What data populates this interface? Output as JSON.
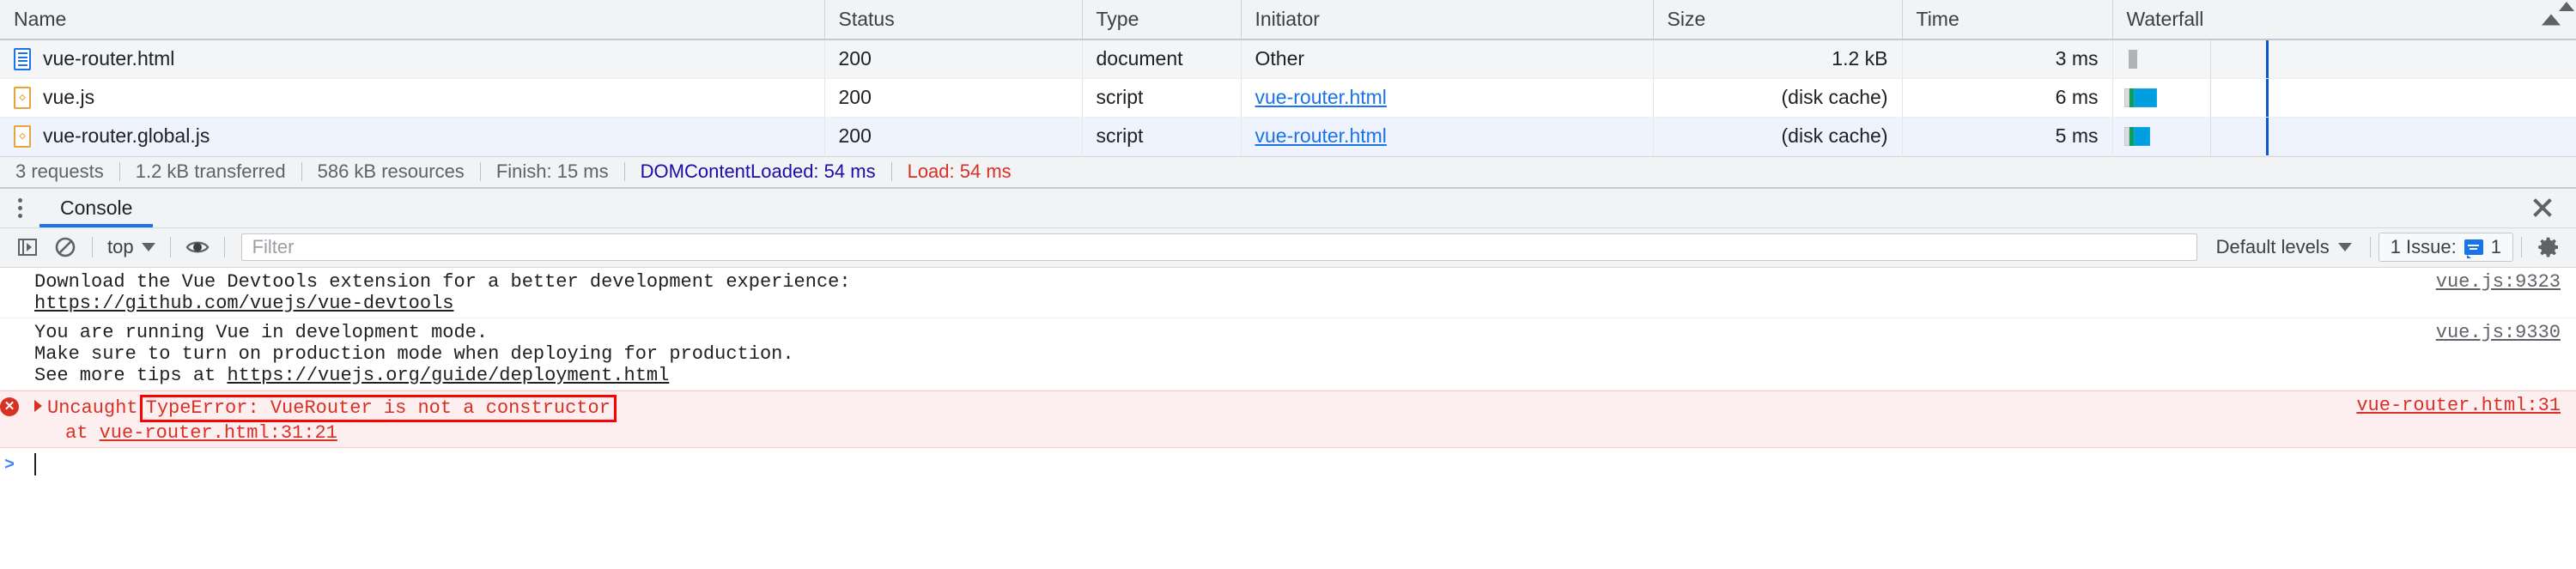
{
  "theme": {
    "accent_blue": "#1a73e8",
    "error_red": "#d93025",
    "annotation_red": "#ff0000",
    "header_bg": "#f1f3f4",
    "selected_row_bg": "#eef3fd",
    "js_icon_color": "#e8a33d",
    "doc_icon_color": "#1a73e8"
  },
  "network": {
    "columns": [
      {
        "key": "name",
        "label": "Name"
      },
      {
        "key": "status",
        "label": "Status"
      },
      {
        "key": "type",
        "label": "Type"
      },
      {
        "key": "initiator",
        "label": "Initiator"
      },
      {
        "key": "size",
        "label": "Size"
      },
      {
        "key": "time",
        "label": "Time"
      },
      {
        "key": "waterfall",
        "label": "Waterfall",
        "sort": "ascending",
        "sort_icon": "triangle-up-icon"
      }
    ],
    "rows": [
      {
        "icon": "document-icon",
        "name": "vue-router.html",
        "status": "200",
        "type": "document",
        "initiator": "Other",
        "initiator_is_link": false,
        "size": "1.2 kB",
        "time": "3 ms",
        "selected": false
      },
      {
        "icon": "script-icon",
        "name": "vue.js",
        "status": "200",
        "type": "script",
        "initiator": "vue-router.html",
        "initiator_is_link": true,
        "size": "(disk cache)",
        "time": "6 ms",
        "selected": false
      },
      {
        "icon": "script-icon",
        "name": "vue-router.global.js",
        "status": "200",
        "type": "script",
        "initiator": "vue-router.html",
        "initiator_is_link": true,
        "size": "(disk cache)",
        "time": "5 ms",
        "selected": true
      }
    ],
    "summary": {
      "requests": "3 requests",
      "transferred": "1.2 kB transferred",
      "resources": "586 kB resources",
      "finish": "Finish: 15 ms",
      "dom_content_loaded": "DOMContentLoaded: 54 ms",
      "load": "Load: 54 ms"
    }
  },
  "drawer": {
    "menu_icon": "kebab-menu-icon",
    "tabs": [
      {
        "label": "Console",
        "active": true
      }
    ],
    "close_icon": "close-icon"
  },
  "console_toolbar": {
    "execute_icon": "execute-snippet-icon",
    "clear_icon": "clear-console-icon",
    "context_value": "top",
    "context_caret": "chevron-down-icon",
    "eye_icon": "live-expression-eye-icon",
    "filter_placeholder": "Filter",
    "filter_value": "",
    "levels_label": "Default levels",
    "levels_caret": "chevron-down-icon",
    "issues_label": "1 Issue:",
    "issues_count": "1",
    "issues_icon": "issue-bubble-icon",
    "settings_icon": "gear-icon"
  },
  "console_messages": [
    {
      "level": "info",
      "lines": [
        {
          "text": "Download the Vue Devtools extension for a better development experience:"
        },
        {
          "text": "https://github.com/vuejs/vue-devtools",
          "link": true
        }
      ],
      "source": "vue.js:9323"
    },
    {
      "level": "info",
      "lines": [
        {
          "text": "You are running Vue in development mode."
        },
        {
          "text": "Make sure to turn on production mode when deploying for production."
        },
        {
          "text": "See more tips at ",
          "trailing_link": "https://vuejs.org/guide/deployment.html"
        }
      ],
      "source": "vue.js:9330"
    },
    {
      "level": "error",
      "expandable": true,
      "prefix": "Uncaught",
      "annotated": "TypeError: VueRouter is not a constructor",
      "stack_prefix": "at ",
      "stack_link": "vue-router.html:31:21",
      "source": "vue-router.html:31"
    }
  ],
  "console_prompt": {
    "arrow": ">",
    "value": ""
  }
}
